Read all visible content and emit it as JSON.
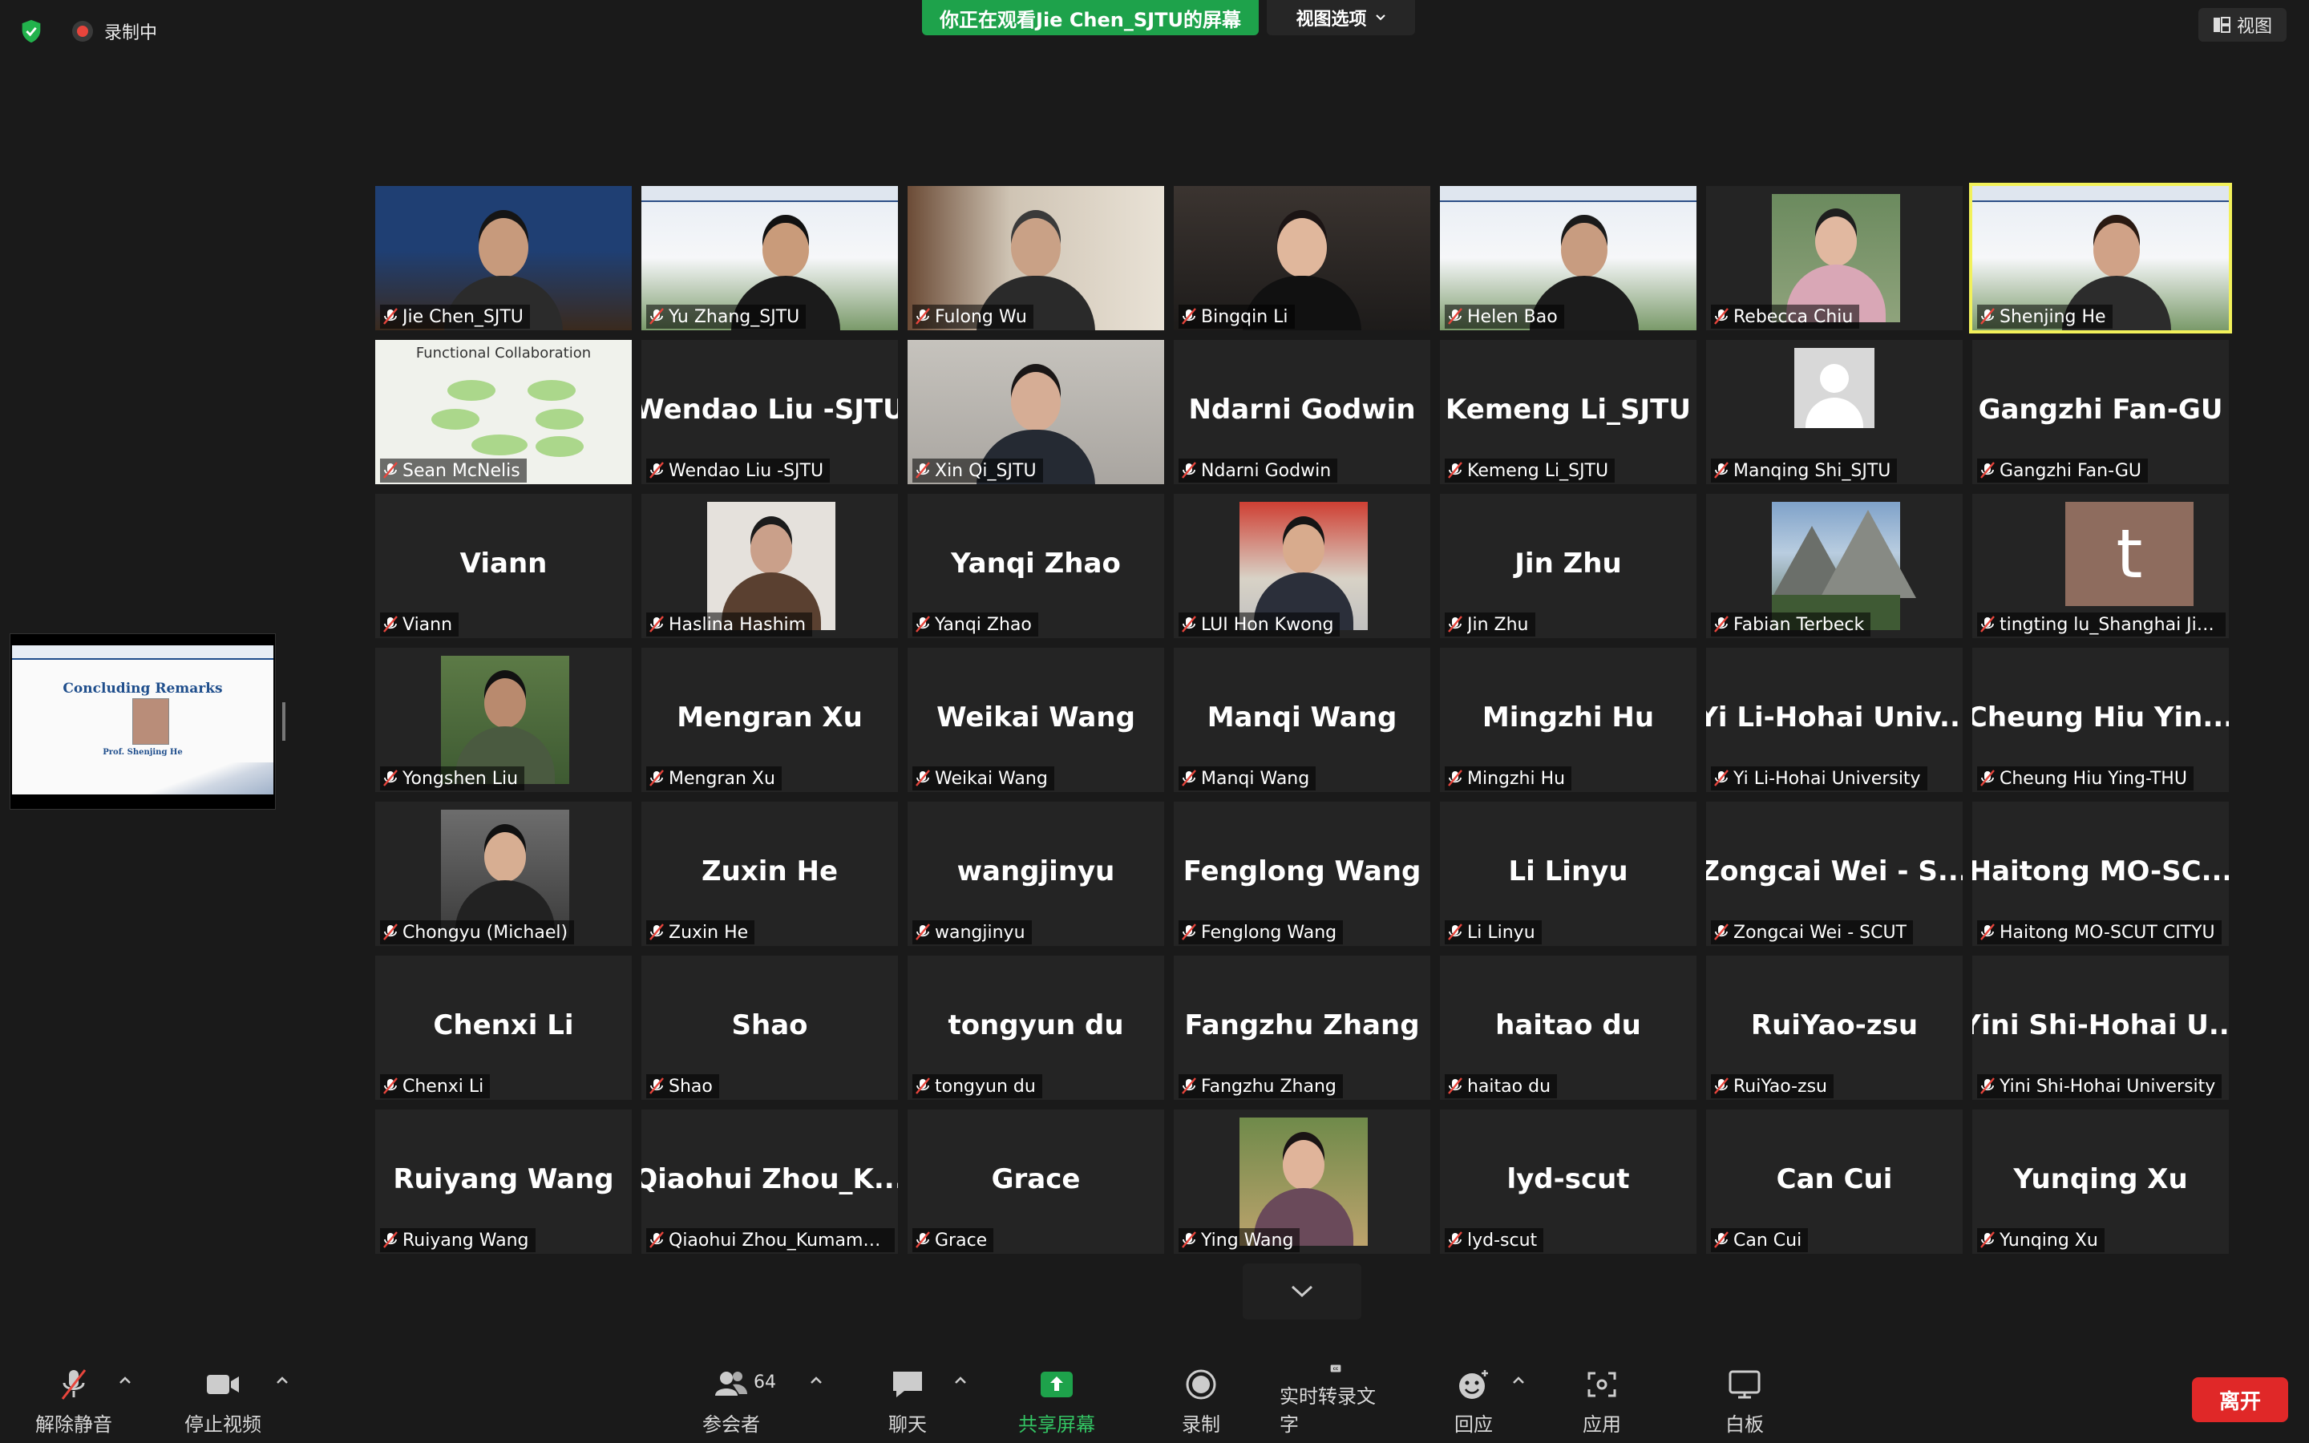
{
  "status": {
    "recording_label": "录制中"
  },
  "share_banner": {
    "text": "你正在观看Jie  Chen_SJTU的屏幕",
    "view_options_label": "视图选项"
  },
  "view_button_label": "视图",
  "shared_slide": {
    "title": "Concluding Remarks",
    "presenter": "Prof. Shenjing He"
  },
  "participants": [
    {
      "name": "Jie Chen_SJTU"
    },
    {
      "name": "Yu Zhang_SJTU"
    },
    {
      "name": "Fulong Wu"
    },
    {
      "name": "Bingqin Li"
    },
    {
      "name": "Helen Bao"
    },
    {
      "name": "Rebecca Chiu"
    },
    {
      "name": "Shenjing He"
    },
    {
      "name": "Sean McNelis"
    },
    {
      "name": "Wendao Liu -SJTU",
      "display": "Wendao Liu -SJTU"
    },
    {
      "name": "Xin Qi_SJTU"
    },
    {
      "name": "Ndarni Godwin",
      "display": "Ndarni Godwin"
    },
    {
      "name": "Kemeng Li_SJTU",
      "display": "Kemeng Li_SJTU"
    },
    {
      "name": "Manqing Shi_SJTU"
    },
    {
      "name": "Gangzhi Fan-GU",
      "display": "Gangzhi Fan-GU"
    },
    {
      "name": "Viann",
      "display": "Viann"
    },
    {
      "name": "Haslina Hashim"
    },
    {
      "name": "Yanqi Zhao",
      "display": "Yanqi Zhao"
    },
    {
      "name": "LUI Hon Kwong"
    },
    {
      "name": "Jin Zhu",
      "display": "Jin Zhu"
    },
    {
      "name": "Fabian Terbeck"
    },
    {
      "name": "tingting lu_Shanghai Jia..."
    },
    {
      "name": "Yongshen Liu"
    },
    {
      "name": "Mengran Xu",
      "display": "Mengran Xu"
    },
    {
      "name": "Weikai Wang",
      "display": "Weikai Wang"
    },
    {
      "name": "Manqi Wang",
      "display": "Manqi Wang"
    },
    {
      "name": "Mingzhi Hu",
      "display": "Mingzhi Hu"
    },
    {
      "name": "Yi Li-Hohai University",
      "display": "Yi Li-Hohai Univ..."
    },
    {
      "name": "Cheung Hiu Ying-THU",
      "display": "Cheung Hiu Yin..."
    },
    {
      "name": "Chongyu (Michael)"
    },
    {
      "name": "Zuxin He",
      "display": "Zuxin He"
    },
    {
      "name": "wangjinyu",
      "display": "wangjinyu"
    },
    {
      "name": "Fenglong Wang",
      "display": "Fenglong Wang"
    },
    {
      "name": "Li Linyu",
      "display": "Li Linyu"
    },
    {
      "name": "Zongcai Wei - SCUT",
      "display": "Zongcai Wei - S..."
    },
    {
      "name": "Haitong MO-SCUT CITYU",
      "display": "Haitong MO-SC..."
    },
    {
      "name": "Chenxi Li",
      "display": "Chenxi Li"
    },
    {
      "name": "Shao",
      "display": "Shao"
    },
    {
      "name": "tongyun du",
      "display": "tongyun du"
    },
    {
      "name": "Fangzhu Zhang",
      "display": "Fangzhu Zhang"
    },
    {
      "name": "haitao du",
      "display": "haitao du"
    },
    {
      "name": "RuiYao-zsu",
      "display": "RuiYao-zsu"
    },
    {
      "name": "Yini Shi-Hohai University",
      "display": "Yini Shi-Hohai U..."
    },
    {
      "name": "Ruiyang Wang",
      "display": "Ruiyang Wang"
    },
    {
      "name": "Qiaohui Zhou_Kumamo...",
      "display": "Qiaohui  Zhou_K..."
    },
    {
      "name": "Grace",
      "display": "Grace"
    },
    {
      "name": "Ying Wang"
    },
    {
      "name": "lyd-scut",
      "display": "lyd-scut"
    },
    {
      "name": "Can Cui",
      "display": "Can Cui"
    },
    {
      "name": "Yunqing Xu",
      "display": "Yunqing Xu"
    }
  ],
  "toolbar": {
    "unmute": "解除静音",
    "stop_video": "停止视频",
    "participants": "参会者",
    "participants_count": "64",
    "chat": "聊天",
    "share_screen": "共享屏幕",
    "record": "录制",
    "live_transcript": "实时转录文字",
    "reactions": "回应",
    "apps": "应用",
    "whiteboard": "白板",
    "leave": "离开"
  },
  "colors": {
    "share_green": "#1ea24b",
    "leave_red": "#e02828",
    "active_speaker": "#f2f15a",
    "mute_red": "#e8453c"
  }
}
